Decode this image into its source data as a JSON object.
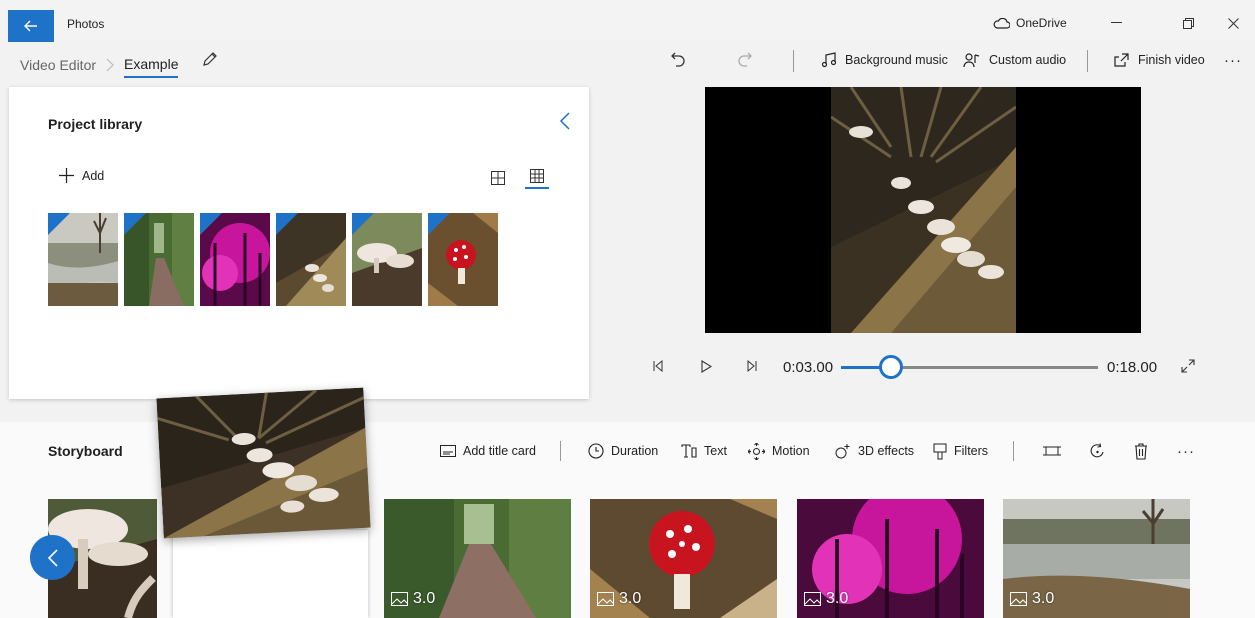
{
  "window": {
    "app_title": "Photos",
    "cloud_label": "OneDrive",
    "cloud_icon": "cloud-icon",
    "accent": "#1e73c8"
  },
  "breadcrumb": {
    "root": "Video Editor",
    "current": "Example"
  },
  "toolbar": {
    "background_music": "Background music",
    "custom_audio": "Custom audio",
    "finish_video": "Finish video",
    "more": "···"
  },
  "library": {
    "title": "Project library",
    "add_label": "Add",
    "items": [
      {
        "name": "river-bank"
      },
      {
        "name": "woodland-path"
      },
      {
        "name": "pink-lit-trees"
      },
      {
        "name": "mushrooms-on-log"
      },
      {
        "name": "white-mushrooms"
      },
      {
        "name": "fly-agaric"
      }
    ]
  },
  "player": {
    "current_time": "0:03.00",
    "total_time": "0:18.00",
    "progress_fraction": 0.195
  },
  "storyboard": {
    "title": "Storyboard",
    "add_title_card": "Add title card",
    "duration": "Duration",
    "text": "Text",
    "motion": "Motion",
    "effects_3d": "3D effects",
    "filters": "Filters",
    "more": "···",
    "clips": [
      {
        "duration": "3.0"
      },
      {
        "duration": "3.0"
      },
      {
        "duration": "3.0"
      },
      {
        "duration": "3.0"
      }
    ]
  }
}
